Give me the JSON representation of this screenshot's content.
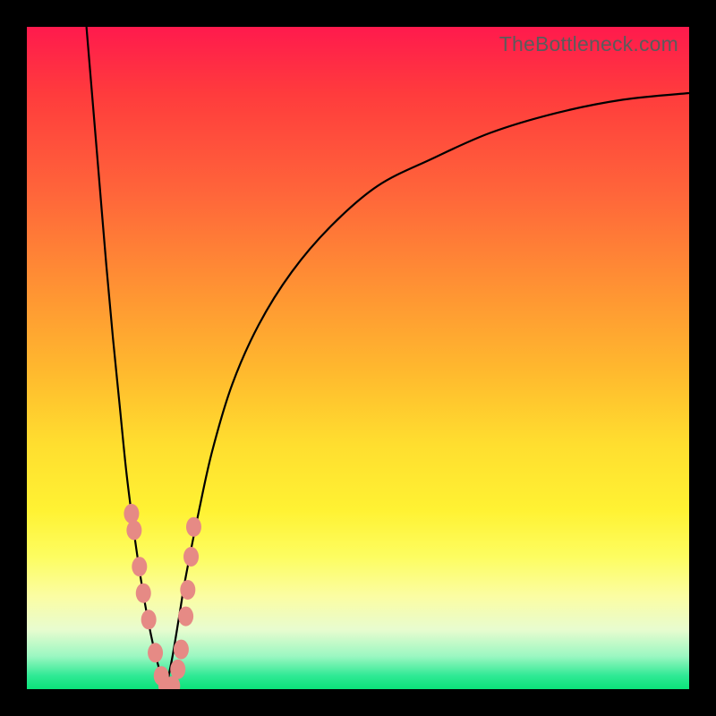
{
  "watermark": "TheBottleneck.com",
  "colors": {
    "frame": "#000000",
    "curve": "#000000",
    "dots": "#e68a85",
    "gradient_top": "#ff1a4d",
    "gradient_bottom": "#0be37a"
  },
  "chart_data": {
    "type": "line",
    "title": "",
    "xlabel": "",
    "ylabel": "",
    "xlim": [
      0,
      100
    ],
    "ylim": [
      0,
      100
    ],
    "note": "No axis ticks or numeric labels are rendered in the image; values are relative percentages of plot area. 0 = left/bottom, 100 = right/top.",
    "series": [
      {
        "name": "left-branch",
        "x": [
          9,
          10,
          11,
          12,
          13,
          14,
          15,
          16,
          17,
          18,
          19,
          20,
          21
        ],
        "y": [
          100,
          88,
          76,
          64,
          53,
          43,
          33,
          25,
          18,
          12,
          7,
          3,
          0
        ]
      },
      {
        "name": "right-branch",
        "x": [
          21,
          22,
          23,
          24,
          26,
          28,
          31,
          35,
          40,
          46,
          53,
          61,
          70,
          80,
          90,
          100
        ],
        "y": [
          0,
          5,
          11,
          17,
          27,
          36,
          46,
          55,
          63,
          70,
          76,
          80,
          84,
          87,
          89,
          90
        ]
      }
    ],
    "scatter_points": {
      "name": "data-dots",
      "x": [
        15.8,
        16.2,
        17.0,
        17.6,
        18.4,
        19.4,
        20.3,
        21.0,
        22.0,
        22.8,
        23.3,
        24.0,
        24.3,
        24.8,
        25.2
      ],
      "y": [
        26.5,
        24.0,
        18.5,
        14.5,
        10.5,
        5.5,
        2.0,
        0.5,
        0.5,
        3.0,
        6.0,
        11.0,
        15.0,
        20.0,
        24.5
      ]
    }
  }
}
